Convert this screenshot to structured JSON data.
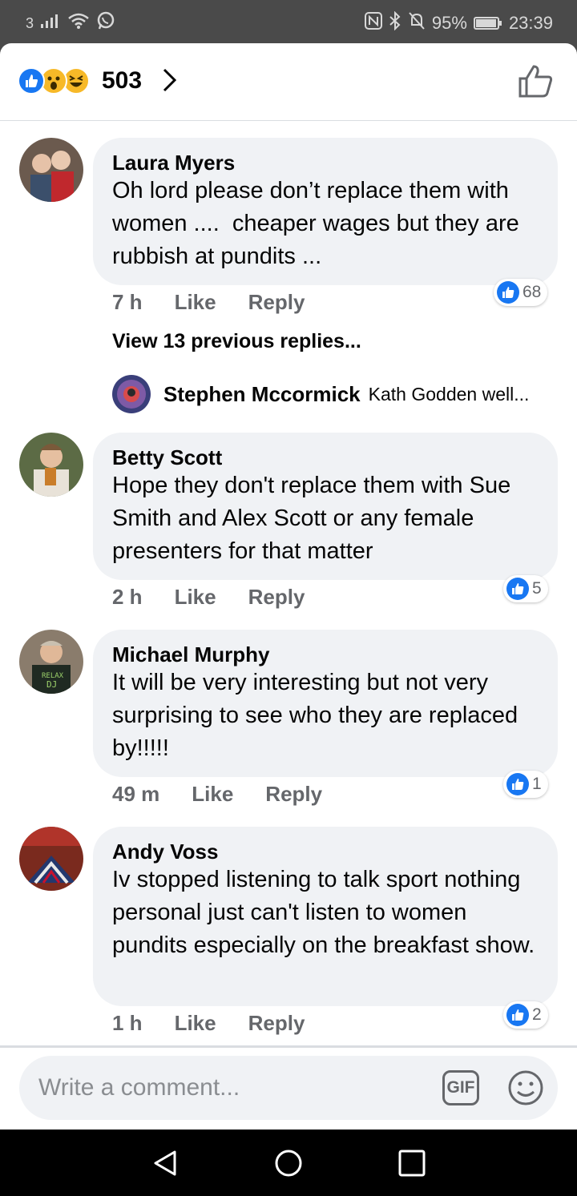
{
  "status_bar": {
    "carrier": "3",
    "battery": "95%",
    "battery_level": 0.95,
    "time": "23:39",
    "icons": [
      "signal-icon",
      "wifi-icon",
      "whatsapp-icon",
      "nfc-icon",
      "bluetooth-icon",
      "mute-icon",
      "battery-icon"
    ]
  },
  "reactions": {
    "count": "503",
    "types": [
      "like",
      "wow",
      "haha"
    ]
  },
  "comments": [
    {
      "author": "Laura Myers",
      "text": "Oh lord please don’t replace them with women ....  cheaper wages but they are rubbish at pundits ...",
      "time": "7 h",
      "like_label": "Like",
      "reply_label": "Reply",
      "reaction_count": "68"
    },
    {
      "author": "Betty Scott",
      "text": "Hope they don't replace them with Sue Smith and Alex Scott or any female presenters for that matter",
      "time": "2 h",
      "like_label": "Like",
      "reply_label": "Reply",
      "reaction_count": "5"
    },
    {
      "author": "Michael Murphy",
      "text": "It will be very interesting but not very surprising to see who they are replaced by!!!!!",
      "time": "49 m",
      "like_label": "Like",
      "reply_label": "Reply",
      "reaction_count": "1"
    },
    {
      "author": "Andy Voss",
      "text": "Iv stopped listening to talk sport nothing personal just can't listen to women pundits especially on the breakfast show.",
      "time": "1 h",
      "like_label": "Like",
      "reply_label": "Reply",
      "reaction_count": "2"
    }
  ],
  "replies": {
    "view_previous": "View 13 previous replies...",
    "preview_author": "Stephen Mccormick",
    "preview_text": "Kath Godden well..."
  },
  "composer": {
    "placeholder": "Write a comment...",
    "gif_label": "GIF"
  },
  "colors": {
    "accent": "#1877f2",
    "bubble": "#f0f2f5",
    "secondary_text": "#65676b"
  }
}
